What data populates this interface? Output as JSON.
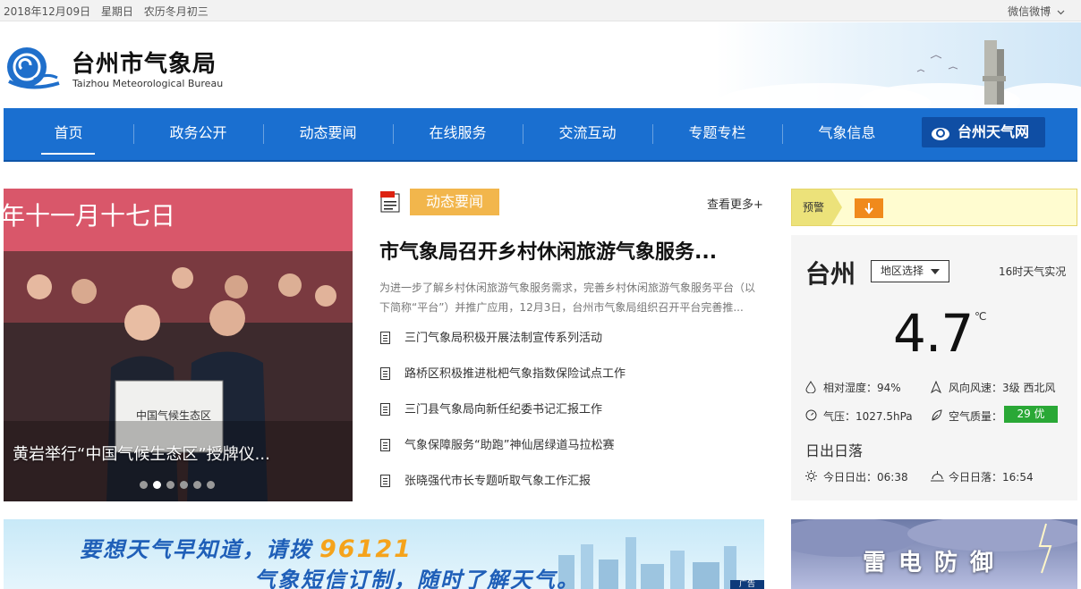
{
  "topbar": {
    "date": "2018年12月09日",
    "weekday": "星期日",
    "lunar": "农历冬月初三",
    "social_label": "微信微博"
  },
  "header": {
    "title_cn": "台州市气象局",
    "title_en": "Taizhou Meteorological Bureau"
  },
  "nav": {
    "items": [
      "首页",
      "政务公开",
      "动态要闻",
      "在线服务",
      "交流互动",
      "专题专栏",
      "气象信息"
    ],
    "active_index": 0,
    "weather_site": "台州天气网"
  },
  "slider": {
    "caption": "黄岩举行“中国气候生态区”授牌仪...",
    "sign_text": "中国气候生态区",
    "backdrop_text": "年十一月十七日",
    "dot_count": 6,
    "active_dot": 1
  },
  "news": {
    "tab_label": "动态要闻",
    "more_label": "查看更多+",
    "headline": "市气象局召开乡村休闲旅游气象服务...",
    "summary": "为进一步了解乡村休闲旅游气象服务需求，完善乡村休闲旅游气象服务平台（以下简称“平台”）并推广应用，12月3日，台州市气象局组织召开平台完善推...",
    "items": [
      "三门气象局积极开展法制宣传系列活动",
      "路桥区积极推进枇杷气象指数保险试点工作",
      "三门县气象局向新任纪委书记汇报工作",
      "气象保障服务“助跑”神仙居绿道马拉松赛",
      "张晓强代市长专题听取气象工作汇报"
    ]
  },
  "alert": {
    "label": "预警"
  },
  "weather": {
    "city": "台州",
    "region_select": "地区选择",
    "observation_time": "16时天气实况",
    "temperature": "4.7",
    "unit": "℃",
    "humidity": "相对湿度：94%",
    "wind": "风向风速：3级 西北风",
    "pressure": "气压：1027.5hPa",
    "air_quality_label": "空气质量：",
    "air_quality_value": "29 优",
    "air_quality_color": "#2aa836",
    "sun_title": "日出日落",
    "sunrise": "今日日出：06:38",
    "sunset": "今日日落：16:54"
  },
  "banners": {
    "left_line1": "要想天气早知道，请拨",
    "left_number": "96121",
    "left_line2": "气象短信订制，随时了解天气。",
    "left_ad": "广告",
    "right_text": "雷电防御"
  },
  "colors": {
    "nav_blue": "#1a6fd0",
    "tab_orange": "#f2b64c",
    "alert_yellow": "#fffcd0"
  }
}
